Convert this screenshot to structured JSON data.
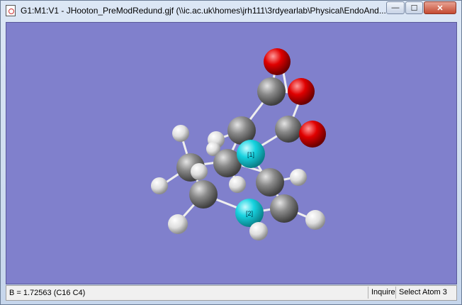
{
  "window": {
    "title": "G1:M1:V1 - JHooton_PreModRedund.gjf (\\\\ic.ac.uk\\homes\\jrh111\\3rdyearlab\\Physical\\EndoAnd...",
    "minimize_glyph": "—",
    "maximize_glyph": "☐",
    "close_glyph": "✕"
  },
  "molecule": {
    "labels": {
      "atom1": "[1]",
      "atom2": "[2]"
    },
    "colors": {
      "background": "#8080cc",
      "carbon": "#8a8a8a",
      "oxygen": "#e00000",
      "hydrogen": "#e6e6e6",
      "selected": "#17d3e0"
    }
  },
  "statusbar": {
    "message": "B = 1.72563 (C16 C4)",
    "mode": "Inquire",
    "action": "Select Atom 3"
  }
}
